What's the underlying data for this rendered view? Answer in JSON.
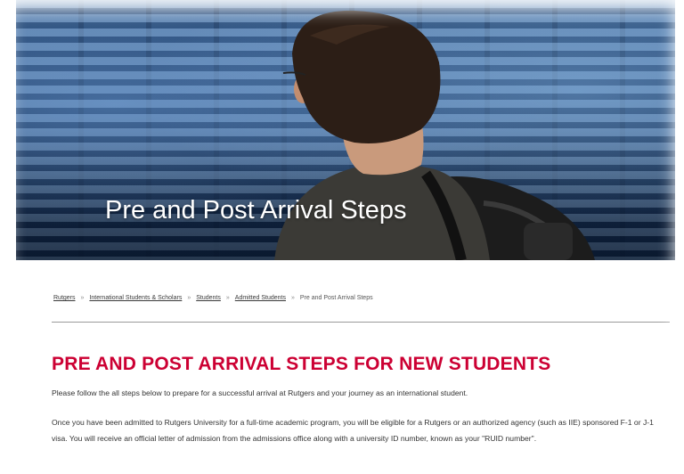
{
  "hero": {
    "title": "Pre and Post Arrival Steps"
  },
  "breadcrumb": {
    "items": [
      "Rutgers",
      "International Students & Scholars",
      "Students",
      "Admitted Students"
    ],
    "separator": "»",
    "current": "Pre and Post Arrival Steps"
  },
  "content": {
    "heading": "PRE AND POST ARRIVAL STEPS FOR NEW STUDENTS",
    "paragraph1": "Please follow the all steps below to prepare for a successful arrival at Rutgers and your journey as an international student.",
    "paragraph2": "Once you have been admitted to Rutgers University for a full-time academic program, you will be eligible for a Rutgers or an authorized agency (such as IIE) sponsored F-1 or J-1 visa. You will receive an official letter of admission from the admissions office along with a university ID number, known as your \"RUID number\"."
  },
  "colors": {
    "heading": "#cc0033",
    "body_text": "#333333",
    "hero_text": "#ffffff"
  }
}
